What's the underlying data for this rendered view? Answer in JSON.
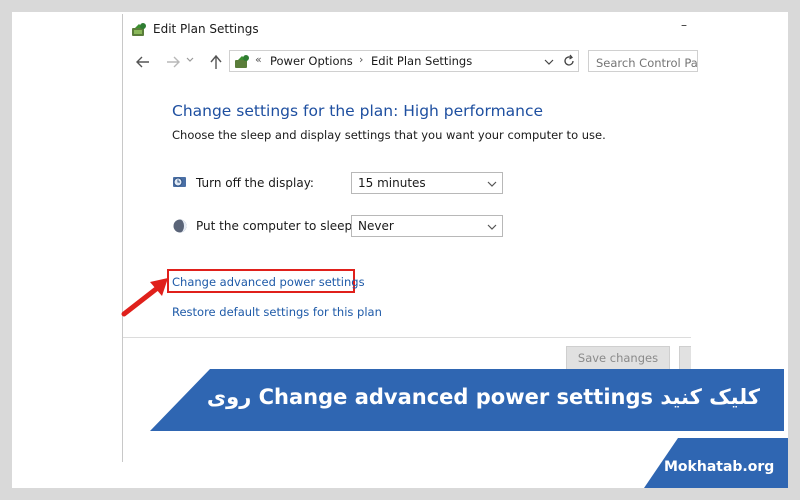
{
  "window": {
    "title": "Edit Plan Settings",
    "minimize_glyph": "–"
  },
  "nav": {
    "back_icon": "back-arrow-icon",
    "forward_icon": "forward-arrow-icon",
    "up_icon": "up-arrow-icon",
    "breadcrumb_prefix": "«",
    "breadcrumbs": [
      "Power Options",
      "Edit Plan Settings"
    ],
    "separator": "›",
    "search_placeholder": "Search Control Pa"
  },
  "main": {
    "heading": "Change settings for the plan: High performance",
    "subheading": "Choose the sleep and display settings that you want your computer to use.",
    "display_label": "Turn off the display:",
    "display_value": "15 minutes",
    "sleep_label": "Put the computer to sleep:",
    "sleep_value": "Never",
    "advanced_link": "Change advanced power settings",
    "restore_link": "Restore default settings for this plan",
    "save_label": "Save changes"
  },
  "banner": {
    "text": "روی Change advanced power settings کلیک کنید"
  },
  "brand": {
    "text": "Mokhatab.org"
  },
  "colors": {
    "banner_blue": "#2f66b2",
    "link_blue": "#1e5aa8",
    "heading_blue": "#1e4fa0",
    "highlight_red": "#e0201b"
  }
}
